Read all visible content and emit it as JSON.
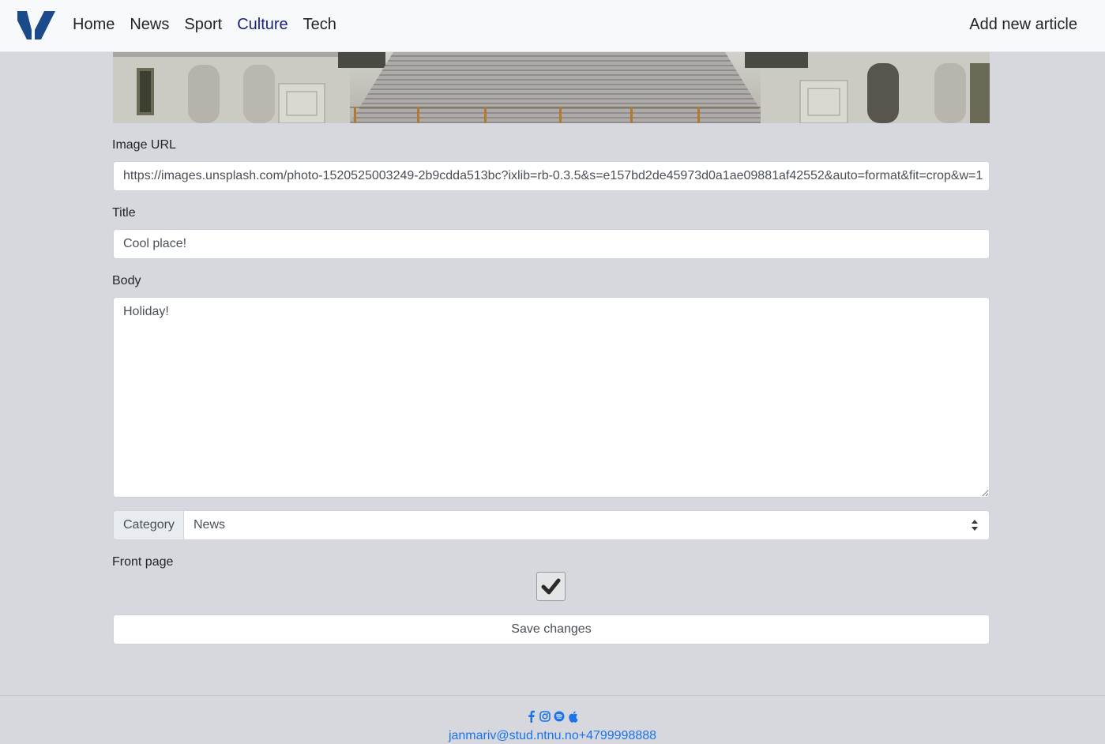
{
  "nav": {
    "links": [
      "Home",
      "News",
      "Sport",
      "Culture",
      "Tech"
    ],
    "active": "Culture",
    "add_article": "Add new article",
    "brand_color": "#1a4a8a"
  },
  "form": {
    "image_url_label": "Image URL",
    "image_url_value": "https://images.unsplash.com/photo-1520525003249-2b9cdda513bc?ixlib=rb-0.3.5&s=e157bd2de45973d0a1ae09881af42552&auto=format&fit=crop&w=1",
    "title_label": "Title",
    "title_value": "Cool place!",
    "body_label": "Body",
    "body_value": "Holiday!",
    "category_label": "Category",
    "category_value": "News",
    "front_page_label": "Front page",
    "front_page_checked": true,
    "save_label": "Save changes"
  },
  "footer": {
    "icons": [
      "facebook-icon",
      "instagram-icon",
      "spotify-icon",
      "apple-icon"
    ],
    "email": "janmariv@stud.ntnu.no",
    "phone": "+4799998888",
    "link_color": "#1a73e8"
  }
}
